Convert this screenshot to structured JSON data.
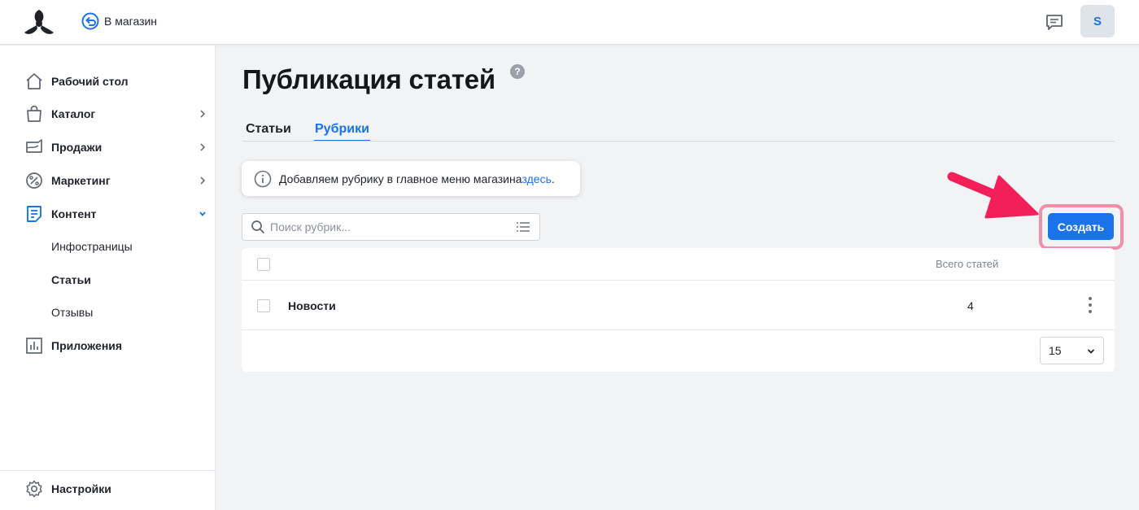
{
  "header": {
    "store_link": "В магазин",
    "avatar_letter": "S"
  },
  "sidebar": {
    "items": [
      {
        "label": "Рабочий стол",
        "icon": "home-icon"
      },
      {
        "label": "Каталог",
        "icon": "shopping-bag-icon"
      },
      {
        "label": "Продажи",
        "icon": "sales-box-icon"
      },
      {
        "label": "Маркетинг",
        "icon": "percent-badge-icon"
      },
      {
        "label": "Контент",
        "icon": "document-icon"
      },
      {
        "label": "Приложения",
        "icon": "bar-chart-icon"
      }
    ],
    "content_subitems": [
      "Инфостраницы",
      "Статьи",
      "Отзывы"
    ],
    "active_subitem": "Статьи",
    "settings_label": "Настройки"
  },
  "page": {
    "title": "Публикация статей",
    "help_symbol": "?",
    "tabs": [
      "Статьи",
      "Рубрики"
    ],
    "active_tab": "Рубрики"
  },
  "info": {
    "text": "Добавляем рубрику в главное меню магазина ",
    "link": "здесь",
    "suffix": "."
  },
  "search": {
    "placeholder": "Поиск рубрик..."
  },
  "create_button": "Создать",
  "table": {
    "count_header": "Всего статей",
    "rows": [
      {
        "name": "Новости",
        "count": "4"
      }
    ],
    "per_page": "15"
  },
  "colors": {
    "accent": "#1a73e8",
    "highlight": "#f08faa",
    "arrow": "#f21f58"
  }
}
